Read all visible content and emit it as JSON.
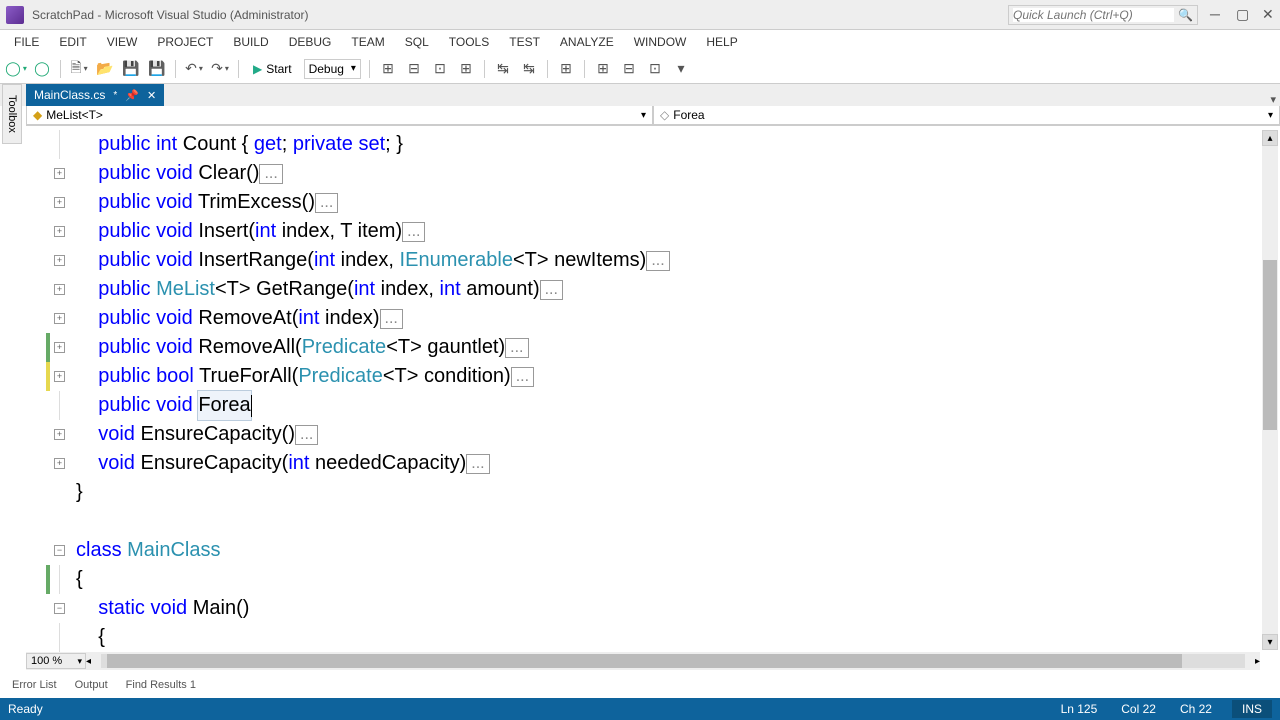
{
  "titlebar": {
    "title": "ScratchPad - Microsoft Visual Studio (Administrator)",
    "quicklaunch_placeholder": "Quick Launch (Ctrl+Q)"
  },
  "menus": [
    "FILE",
    "EDIT",
    "VIEW",
    "PROJECT",
    "BUILD",
    "DEBUG",
    "TEAM",
    "SQL",
    "TOOLS",
    "TEST",
    "ANALYZE",
    "WINDOW",
    "HELP"
  ],
  "toolbar": {
    "start_label": "Start",
    "config": "Debug"
  },
  "tab": {
    "name": "MainClass.cs",
    "modified": "*"
  },
  "nav": {
    "class_label": "MeList<T>",
    "member_label": "Forea"
  },
  "zoom": "100 %",
  "toolbox_label": "Toolbox",
  "bottom_tabs": [
    "Error List",
    "Output",
    "Find Results 1"
  ],
  "status": {
    "ready": "Ready",
    "ln": "Ln 125",
    "col": "Col 22",
    "ch": "Ch 22",
    "ins": "INS"
  },
  "code": {
    "l1_kw1": "public",
    "l1_kw2": "int",
    "l1_name": "Count",
    "l1_open": " { ",
    "l1_get": "get",
    "l1_sep": "; ",
    "l1_priv": "private",
    "l1_sp": " ",
    "l1_set": "set",
    "l1_close": "; }",
    "l2_kw1": "public",
    "l2_kw2": "void",
    "l2_name": " Clear()",
    "l3_kw1": "public",
    "l3_kw2": "void",
    "l3_name": " TrimExcess()",
    "l4_kw1": "public",
    "l4_kw2": "void",
    "l4_name": " Insert(",
    "l4_int": "int",
    "l4_rest": " index, T item)",
    "l5_kw1": "public",
    "l5_kw2": "void",
    "l5_name": " InsertRange(",
    "l5_int": "int",
    "l5_idx": " index, ",
    "l5_ienum": "IEnumerable",
    "l5_rest": "<T> newItems)",
    "l6_kw1": "public",
    "l6_type": "MeList",
    "l6_gen": "<T>",
    "l6_name": " GetRange(",
    "l6_int": "int",
    "l6_idx": " index, ",
    "l6_int2": "int",
    "l6_rest": " amount)",
    "l7_kw1": "public",
    "l7_kw2": "void",
    "l7_name": " RemoveAt(",
    "l7_int": "int",
    "l7_rest": " index)",
    "l8_kw1": "public",
    "l8_kw2": "void",
    "l8_name": " RemoveAll(",
    "l8_pred": "Predicate",
    "l8_rest": "<T> gauntlet)",
    "l9_kw1": "public",
    "l9_kw2": "bool",
    "l9_name": " TrueForAll(",
    "l9_pred": "Predicate",
    "l9_rest": "<T> condition)",
    "l10_kw1": "public",
    "l10_kw2": "void",
    "l10_name": "Forea",
    "l11_kw": "void",
    "l11_name": " EnsureCapacity()",
    "l12_kw": "void",
    "l12_name": " EnsureCapacity(",
    "l12_int": "int",
    "l12_rest": " neededCapacity)",
    "l13_brace": "}",
    "l14_kw": "class",
    "l14_name": "MainClass",
    "l15_brace": "{",
    "l16_kw1": "static",
    "l16_kw2": "void",
    "l16_name": " Main()",
    "l17_brace": "{",
    "fold": "..."
  }
}
